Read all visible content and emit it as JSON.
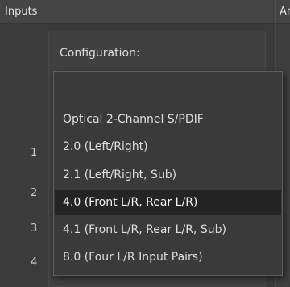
{
  "tabs": {
    "inputs_label": "Inputs",
    "next_label": "Ar"
  },
  "panel": {
    "configuration_label": "Configuration:"
  },
  "row_numbers": [
    "1",
    "2",
    "3",
    "4"
  ],
  "dropdown": {
    "options": [
      {
        "label": "",
        "selected": false
      },
      {
        "label": "Optical 2-Channel S/PDIF",
        "selected": false
      },
      {
        "label": "2.0 (Left/Right)",
        "selected": false
      },
      {
        "label": "2.1 (Left/Right, Sub)",
        "selected": false
      },
      {
        "label": "4.0 (Front L/R, Rear L/R)",
        "selected": true
      },
      {
        "label": "4.1 (Front L/R, Rear L/R, Sub)",
        "selected": false
      },
      {
        "label": "8.0 (Four L/R Input Pairs)",
        "selected": false
      }
    ]
  },
  "colors": {
    "background": "#3b3b3b",
    "dropdown_background": "#3a3a3a",
    "selected_background": "#242424",
    "text": "#dedede"
  }
}
